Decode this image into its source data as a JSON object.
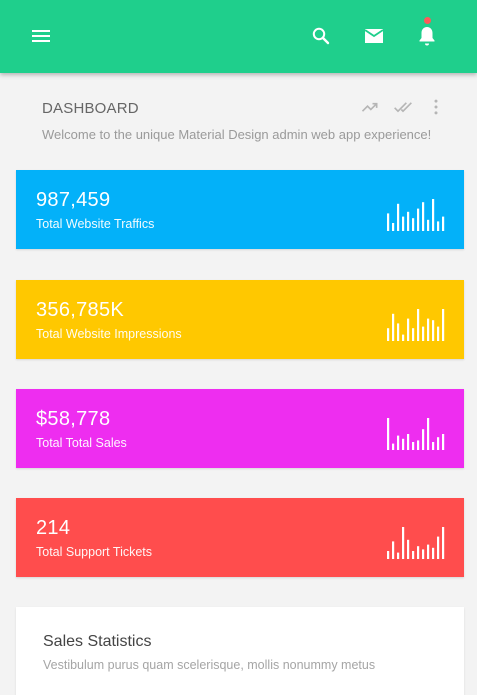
{
  "topbar": {
    "color": "#1fcf8c",
    "icons": [
      "menu-icon",
      "search-icon",
      "mail-icon",
      "bell-icon"
    ],
    "notification_dot_color": "#ff5a5a"
  },
  "header": {
    "title": "DASHBOARD",
    "subtitle": "Welcome to the unique Material Design admin web app experience!",
    "actions": [
      "trending-up-icon",
      "done-all-icon",
      "more-vert-icon"
    ]
  },
  "stats": [
    {
      "value": "987,459",
      "label": "Total Website Traffics",
      "color": "#03b1f9",
      "bars": [
        0.55,
        0.25,
        0.85,
        0.45,
        0.6,
        0.4,
        0.7,
        0.9,
        0.35,
        1.0,
        0.3,
        0.45
      ]
    },
    {
      "value": "356,785K",
      "label": "Total Website Impressions",
      "color": "#ffc800",
      "bars": [
        0.4,
        0.85,
        0.55,
        0.2,
        0.7,
        0.4,
        1.0,
        0.45,
        0.7,
        0.65,
        0.45,
        1.0
      ]
    },
    {
      "value": "$58,778",
      "label": "Total Total Sales",
      "color": "#ee2df0",
      "bars": [
        1.0,
        0.2,
        0.45,
        0.35,
        0.5,
        0.25,
        0.3,
        0.65,
        1.0,
        0.25,
        0.4,
        0.5
      ]
    },
    {
      "value": "214",
      "label": "Total Support Tickets",
      "color": "#ff4d4d",
      "bars": [
        0.25,
        0.55,
        0.2,
        1.0,
        0.6,
        0.25,
        0.4,
        0.3,
        0.45,
        0.35,
        0.7,
        1.0
      ]
    }
  ],
  "sales": {
    "title": "Sales Statistics",
    "subtitle": "Vestibulum purus quam scelerisque, mollis nonummy metus"
  }
}
